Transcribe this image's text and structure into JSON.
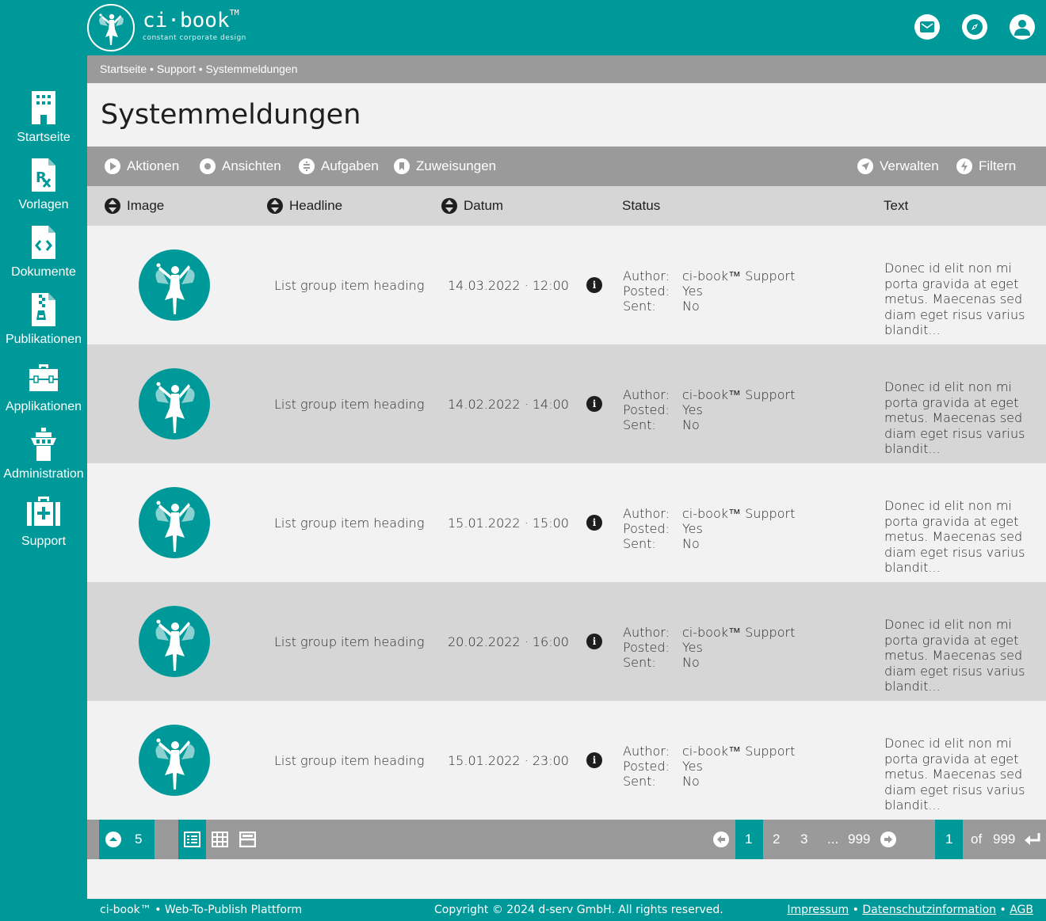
{
  "brand": {
    "name": "ci·book",
    "tm": "TM",
    "tagline": "constant corporate design"
  },
  "header_icons": [
    "mail-icon",
    "compass-icon",
    "user-icon"
  ],
  "sidebar": {
    "items": [
      {
        "label": "Startseite",
        "icon": "building-icon"
      },
      {
        "label": "Vorlagen",
        "icon": "prescription-file-icon"
      },
      {
        "label": "Dokumente",
        "icon": "code-file-icon"
      },
      {
        "label": "Publikationen",
        "icon": "zip-file-icon"
      },
      {
        "label": "Applikationen",
        "icon": "toolbox-icon"
      },
      {
        "label": "Administration",
        "icon": "tower-icon"
      },
      {
        "label": "Support",
        "icon": "medical-kit-icon"
      }
    ]
  },
  "breadcrumb": "Startseite • Support • Systemmeldungen",
  "page_title": "Systemmeldungen",
  "toolbar": {
    "actions": "Aktionen",
    "views": "Ansichten",
    "tasks": "Aufgaben",
    "assignments": "Zuweisungen",
    "manage": "Verwalten",
    "filter": "Filtern"
  },
  "columns": {
    "image": "Image",
    "headline": "Headline",
    "date": "Datum",
    "status": "Status",
    "text": "Text"
  },
  "status_labels": {
    "author": "Author:",
    "posted": "Posted:",
    "sent": "Sent:"
  },
  "rows": [
    {
      "headline": "List group item heading",
      "date": "14.03.2022 · 12:00",
      "author": "ci-book™ Support",
      "posted": "Yes",
      "sent": "No",
      "text": "Donec id elit non mi porta gravida at eget metus. Maecenas sed diam eget risus varius blandit..."
    },
    {
      "headline": "List group item heading",
      "date": "14.02.2022 · 14:00",
      "author": "ci-book™ Support",
      "posted": "Yes",
      "sent": "No",
      "text": "Donec id elit non mi porta gravida at eget metus. Maecenas sed diam eget risus varius blandit..."
    },
    {
      "headline": "List group item heading",
      "date": "15.01.2022 · 15:00",
      "author": "ci-book™ Support",
      "posted": "Yes",
      "sent": "No",
      "text": "Donec id elit non mi porta gravida at eget metus. Maecenas sed diam eget risus varius blandit..."
    },
    {
      "headline": "List group item heading",
      "date": "20.02.2022 · 16:00",
      "author": "ci-book™ Support",
      "posted": "Yes",
      "sent": "No",
      "text": "Donec id elit non mi porta gravida at eget metus. Maecenas sed diam eget risus varius blandit..."
    },
    {
      "headline": "List group item heading",
      "date": "15.01.2022 · 23:00",
      "author": "ci-book™ Support",
      "posted": "Yes",
      "sent": "No",
      "text": "Donec id elit non mi porta gravida at eget metus. Maecenas sed diam eget risus varius blandit..."
    }
  ],
  "pagination": {
    "per_page": "5",
    "pages": [
      "1",
      "2",
      "3",
      "...",
      "999"
    ],
    "current": "1",
    "jump_value": "1",
    "of_label": "of",
    "total": "999"
  },
  "footer": {
    "left": "ci-book™ • Web-To-Publish Plattform",
    "copyright": "Copyright © 2024 d-serv GmbH. All rights reserved.",
    "impressum": "Impressum",
    "datenschutz": "Datenschutzinformation",
    "agb": "AGB",
    "sep": "•"
  },
  "colors": {
    "accent": "#009999",
    "bar": "#9a9a9a",
    "row_alt": "#d6d6d6",
    "background": "#f2f2f2"
  }
}
